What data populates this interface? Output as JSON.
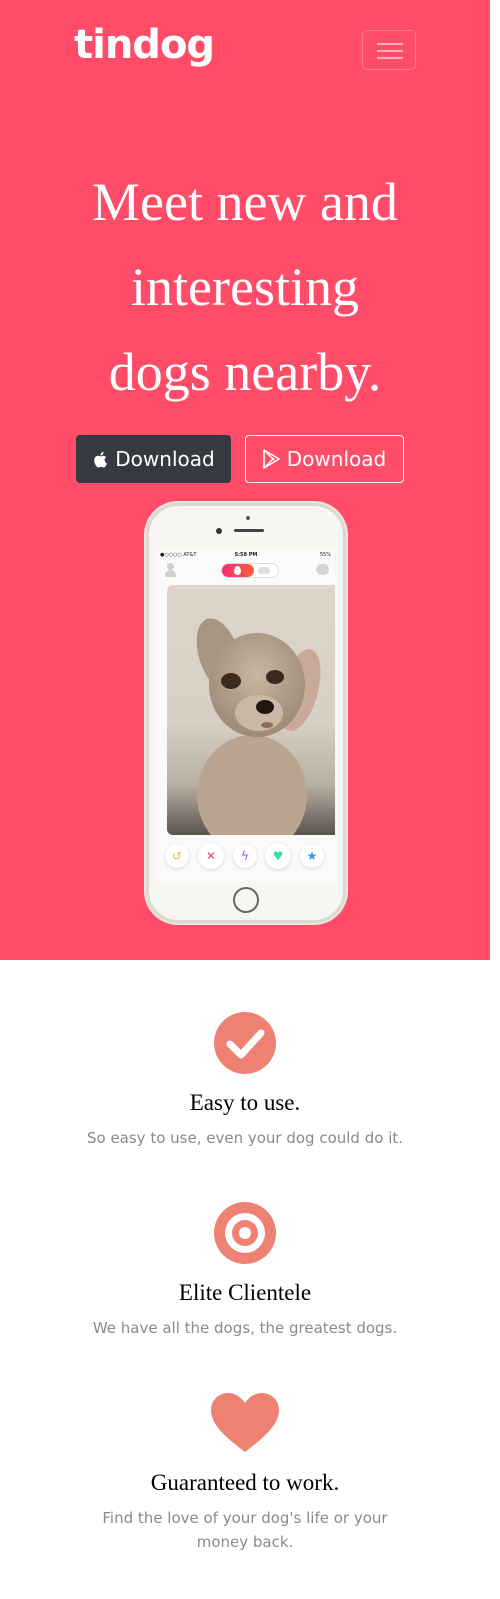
{
  "navbar": {
    "brand": "tindog",
    "menu_icon": "hamburger-icon"
  },
  "hero": {
    "headline_lines": [
      "Meet new and",
      "interesting",
      "dogs nearby."
    ],
    "buttons": [
      {
        "label": "Download",
        "icon": "apple-icon",
        "style": "dark"
      },
      {
        "label": "Download",
        "icon": "google-play-icon",
        "style": "outline"
      }
    ],
    "colors": {
      "background": "#ff4c68",
      "dark_button": "#343a40",
      "feature_icon": "#ef8172"
    }
  },
  "phone": {
    "status": {
      "carrier": "●○○○○ AT&T",
      "time": "5:58 PM",
      "battery": "55%"
    },
    "action_icons": [
      "rewind-icon",
      "nope-x-icon",
      "boost-icon",
      "like-heart-icon",
      "super-like-star-icon"
    ]
  },
  "features": [
    {
      "icon": "check-circle-icon",
      "title": "Easy to use.",
      "text": "So easy to use, even your dog could do it."
    },
    {
      "icon": "bullseye-icon",
      "title": "Elite Clientele",
      "text": "We have all the dogs, the greatest dogs."
    },
    {
      "icon": "heart-icon",
      "title": "Guaranteed to work.",
      "text": "Find the love of your dog's life or your money back."
    }
  ]
}
